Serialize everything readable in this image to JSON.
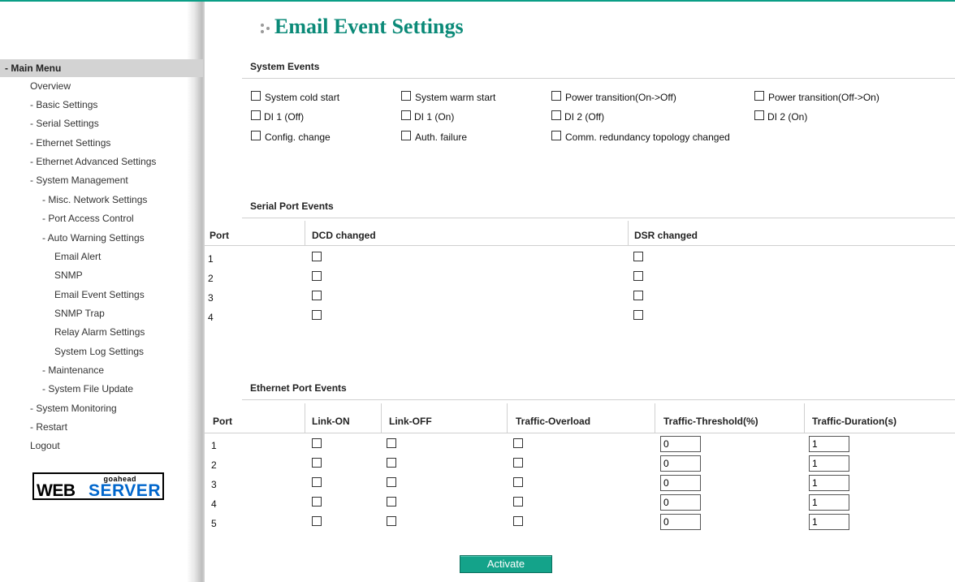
{
  "page": {
    "title": "Email Event Settings"
  },
  "sidebar": {
    "header": "- Main Menu",
    "items": [
      {
        "label": "Overview"
      },
      {
        "label": "- Basic Settings"
      },
      {
        "label": "- Serial Settings"
      },
      {
        "label": "- Ethernet Settings"
      },
      {
        "label": "- Ethernet Advanced Settings"
      },
      {
        "label": "- System Management"
      },
      {
        "label": "- Misc. Network Settings"
      },
      {
        "label": "- Port Access Control"
      },
      {
        "label": "- Auto Warning Settings"
      },
      {
        "label": "Email Alert"
      },
      {
        "label": "SNMP"
      },
      {
        "label": "Email Event Settings"
      },
      {
        "label": "SNMP Trap"
      },
      {
        "label": "Relay Alarm Settings"
      },
      {
        "label": "System Log Settings"
      },
      {
        "label": "- Maintenance"
      },
      {
        "label": "- System File Update"
      },
      {
        "label": "- System Monitoring"
      },
      {
        "label": "- Restart"
      },
      {
        "label": "Logout"
      }
    ],
    "logo": {
      "small": "goahead",
      "web": "WEB",
      "server": "SERVER"
    }
  },
  "system_events": {
    "title": "System Events",
    "items": [
      {
        "label": "System cold start",
        "checked": false
      },
      {
        "label": "System warm start",
        "checked": false
      },
      {
        "label": "Power transition(On->Off)",
        "checked": false
      },
      {
        "label": "Power transition(Off->On)",
        "checked": false
      },
      {
        "label": "DI 1 (Off)",
        "checked": false
      },
      {
        "label": "DI 1 (On)",
        "checked": false
      },
      {
        "label": "DI 2 (Off)",
        "checked": false
      },
      {
        "label": "DI 2 (On)",
        "checked": false
      },
      {
        "label": "Config. change",
        "checked": false
      },
      {
        "label": "Auth. failure",
        "checked": false
      },
      {
        "label": "Comm. redundancy topology changed",
        "checked": false
      }
    ]
  },
  "serial_events": {
    "title": "Serial Port Events",
    "columns": [
      "Port",
      "DCD changed",
      "DSR changed"
    ],
    "rows": [
      {
        "port": "1",
        "dcd": false,
        "dsr": false
      },
      {
        "port": "2",
        "dcd": false,
        "dsr": false
      },
      {
        "port": "3",
        "dcd": false,
        "dsr": false
      },
      {
        "port": "4",
        "dcd": false,
        "dsr": false
      }
    ]
  },
  "ethernet_events": {
    "title": "Ethernet Port Events",
    "columns": [
      "Port",
      "Link-ON",
      "Link-OFF",
      "Traffic-Overload",
      "Traffic-Threshold(%)",
      "Traffic-Duration(s)"
    ],
    "rows": [
      {
        "port": "1",
        "threshold": "0",
        "duration": "1"
      },
      {
        "port": "2",
        "threshold": "0",
        "duration": "1"
      },
      {
        "port": "3",
        "threshold": "0",
        "duration": "1"
      },
      {
        "port": "4",
        "threshold": "0",
        "duration": "1"
      },
      {
        "port": "5",
        "threshold": "0",
        "duration": "1"
      }
    ]
  },
  "actions": {
    "activate_label": "Activate"
  },
  "colors": {
    "accent": "#0b8a78",
    "button": "#14a38a",
    "menu_header_bg": "#d3d3d3",
    "logo_blue": "#0066cc"
  }
}
